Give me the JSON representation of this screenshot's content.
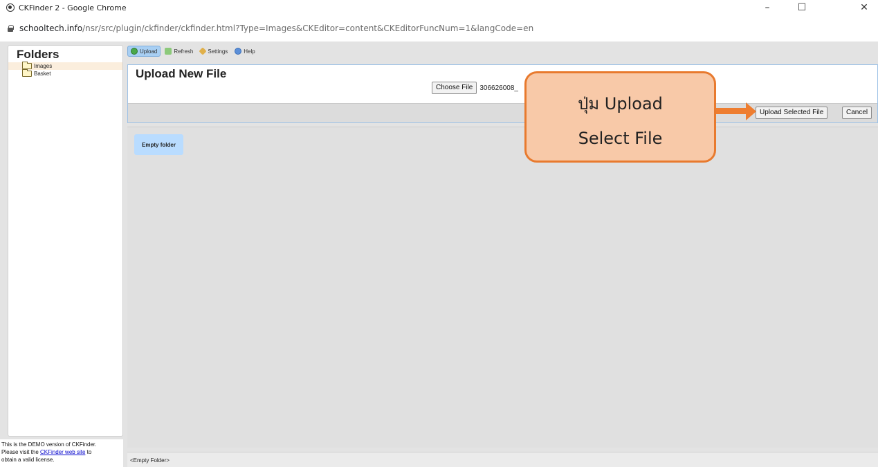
{
  "window": {
    "title": "CKFinder 2 - Google Chrome",
    "controls": {
      "minimize": "–",
      "maximize": "☐",
      "close": "✕"
    }
  },
  "address": {
    "host": "schooltech.info",
    "path": "/nsr/src/plugin/ckfinder/ckfinder.html?Type=Images&CKEditor=content&CKEditorFuncNum=1&langCode=en"
  },
  "sidebar": {
    "header": "Folders",
    "items": [
      {
        "label": "Images",
        "selected": true
      },
      {
        "label": "Basket",
        "selected": false
      }
    ],
    "demo_note": {
      "line1": "This is the DEMO version of CKFinder.",
      "pre_link": "Please visit the ",
      "link": "CKFinder web site",
      "post_link": " to",
      "line3": "obtain a valid license."
    }
  },
  "toolbar": {
    "upload": "Upload",
    "refresh": "Refresh",
    "settings": "Settings",
    "help": "Help"
  },
  "upload_panel": {
    "title": "Upload New File",
    "choose_label": "Choose File",
    "file_name": "306626008_",
    "upload_selected": "Upload Selected File",
    "cancel": "Cancel"
  },
  "files": {
    "empty_label": "Empty folder",
    "status": "<Empty Folder>"
  },
  "annotation": {
    "line1": "ปุ่ม Upload",
    "line2": "Select File",
    "fill": "#f8c9a8",
    "border": "#e87a2e",
    "arrow": "#ee7d30"
  }
}
